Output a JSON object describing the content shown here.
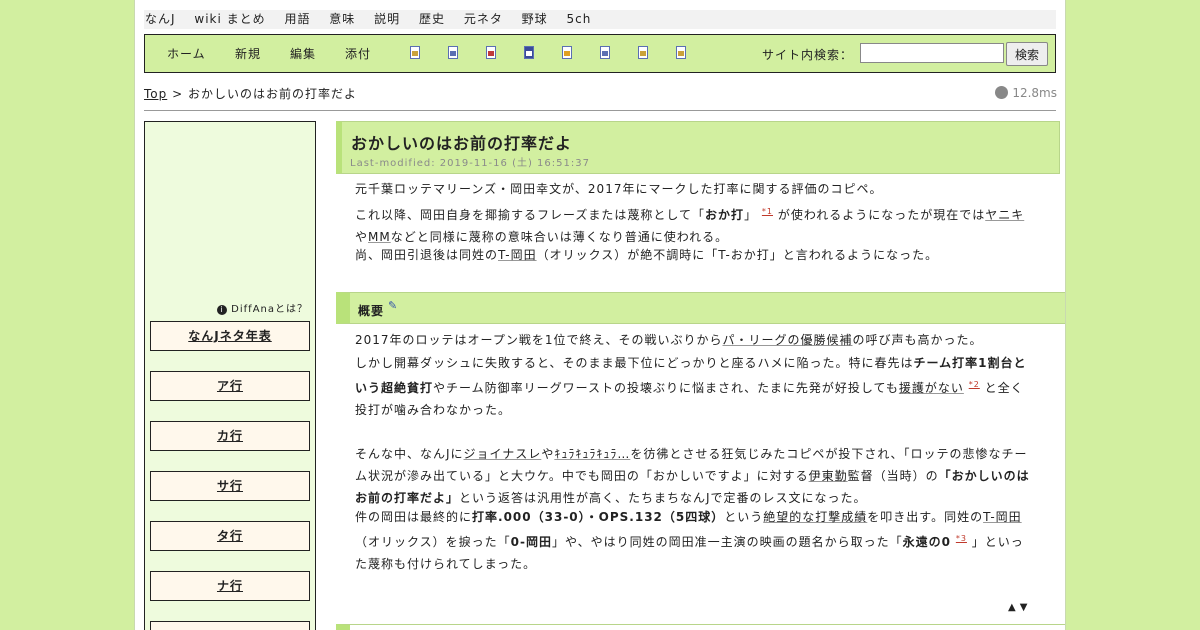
{
  "topnav": [
    "なんJ",
    "wiki まとめ",
    "用語",
    "意味",
    "説明",
    "歴史",
    "元ネタ",
    "野球",
    "5ch"
  ],
  "menu": {
    "items": [
      "ホーム",
      "新規",
      "編集",
      "添付"
    ],
    "search_label": "サイト内検索：",
    "search_value": "",
    "search_button": "検索"
  },
  "breadcrumb": {
    "top": "Top",
    "sep": ">",
    "current": "おかしいのはお前の打率だよ"
  },
  "timing": "12.8ms",
  "sidebar": {
    "diffana": "DiffAnaとは？",
    "items": [
      "なんJネタ年表",
      "ア行",
      "カ行",
      "サ行",
      "タ行",
      "ナ行"
    ]
  },
  "article": {
    "title": "おかしいのはお前の打率だよ",
    "last_modified": "Last-modified: 2019-11-16 (土) 16:51:37",
    "intro": {
      "p1": "元千葉ロッテマリーンズ・岡田幸文が、2017年にマークした打率に関する評価のコピペ。",
      "p2_a": "これ以降、岡田自身を揶揄するフレーズまたは蔑称として「",
      "p2_b": "おか打",
      "p2_c": "」",
      "p2_fn": "*1",
      "p2_d": " が使われるようになったが現在では",
      "p2_e": "ヤニキ",
      "p2_f": "や",
      "p2_g": "MM",
      "p2_h": "などと同様に蔑称の意味合いは薄くなり普通に使われる。",
      "p3_a": "尚、岡田引退後は同姓の",
      "p3_b": "T-岡田",
      "p3_c": "（オリックス）が絶不調時に「T-おか打」と言われるようになった。"
    },
    "section_title": "概要",
    "summary": {
      "l1_a": "2017年のロッテはオープン戦を1位で終え、その戦いぶりから",
      "l1_b": "パ・リーグの優勝候補",
      "l1_c": "の呼び声も高かった。",
      "l2_a": "しかし開幕ダッシュに失敗すると、そのまま最下位にどっかりと座るハメに陥った。特に春先は",
      "l2_b": "チーム打率1割台という超絶貧打",
      "l2_c": "やチーム防御率リーグワーストの投壊ぶりに悩まされ、たまに先発が好投しても",
      "l2_d": "援護がない",
      "l2_fn": "*2",
      "l2_e": " と全く投打が噛み合わなかった。",
      "l3_a": "そんな中、なんJに",
      "l3_b": "ジョイナスレ",
      "l3_c": "や",
      "l3_d": "ｷｭﾗｷｭﾗｷｭﾗ…",
      "l3_e": "を彷彿とさせる狂気じみたコピペが投下され、「ロッテの悲惨なチーム状況が滲み出ている」と大ウケ。中でも岡田の「おかしいですよ」に対する",
      "l3_f": "伊東勤",
      "l3_g": "監督（当時）の",
      "l3_h": "「おかしいのはお前の打率だよ」",
      "l3_i": "という返答は汎用性が高く、たちまちなんJで定番のレス文になった。",
      "l4_a": "件の岡田は最終的に",
      "l4_b": "打率.000（33-0）・OPS.132（5四球）",
      "l4_c": "という",
      "l4_d": "絶望的な打撃成績",
      "l4_e": "を叩き出す。同姓の",
      "l4_f": "T-岡田",
      "l4_g": "（オリックス）を捩った「",
      "l4_h": "0-岡田",
      "l4_i": "」や、やはり同姓の岡田准一主演の映画の題名から取った「",
      "l4_j": "永遠の0",
      "l4_fn": "*3",
      "l4_k": " 」といった蔑称も付けられてしまった。"
    },
    "updown": "▲▼"
  },
  "colors": {
    "page_bg": "#d2efa0",
    "sidebar_bg": "#eefbdd",
    "box_bg": "#fff8ec",
    "heading_bg": "#d2efa0",
    "footnote": "#c0392b"
  }
}
